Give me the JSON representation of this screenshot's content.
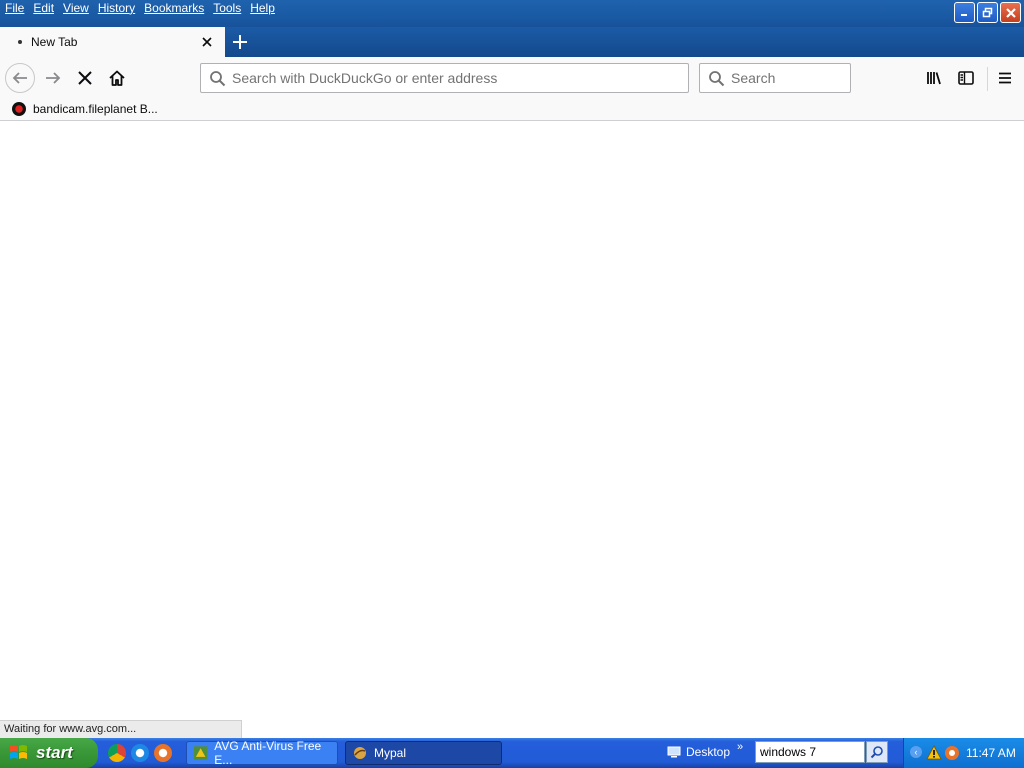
{
  "menu": [
    "File",
    "Edit",
    "View",
    "History",
    "Bookmarks",
    "Tools",
    "Help"
  ],
  "tab": {
    "title": "New Tab"
  },
  "urlbar": {
    "placeholder": "Search with DuckDuckGo or enter address"
  },
  "searchbar": {
    "placeholder": "Search"
  },
  "bookmarks": [
    {
      "label": "bandicam.fileplanet  B..."
    }
  ],
  "status": "Waiting for www.avg.com...",
  "taskbar": {
    "start_label": "start",
    "tasks": [
      {
        "label": "AVG Anti-Virus Free E...",
        "icon": "avg-icon",
        "active": false
      },
      {
        "label": "Mypal",
        "icon": "mypal-icon",
        "active": true
      }
    ],
    "desktop_label": "Desktop",
    "search_value": "windows 7",
    "clock": "11:47 AM"
  },
  "colors": {
    "titlebar": "#1a5aa4",
    "toolbar": "#f9f9fa",
    "taskbar": "#245edb",
    "start": "#3c9a3a",
    "tray": "#0f6fd0"
  }
}
